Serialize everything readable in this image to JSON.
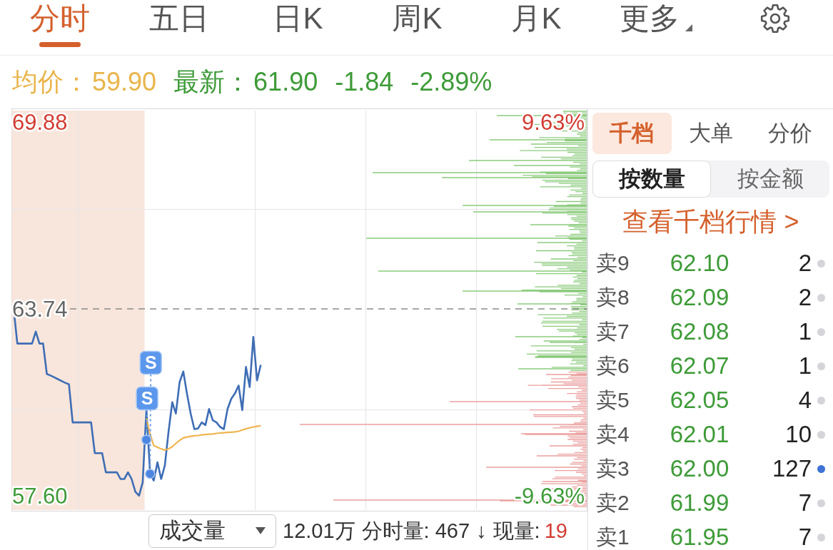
{
  "tabs": [
    {
      "label": "分时",
      "selected": true,
      "kind": "tab"
    },
    {
      "label": "五日",
      "selected": false,
      "kind": "tab"
    },
    {
      "label": "日K",
      "selected": false,
      "kind": "tab"
    },
    {
      "label": "周K",
      "selected": false,
      "kind": "tab"
    },
    {
      "label": "月K",
      "selected": false,
      "kind": "tab"
    },
    {
      "label": "更多",
      "selected": false,
      "kind": "menu"
    }
  ],
  "quote": {
    "avg_label": "均价：",
    "avg": "59.90",
    "last_label": "最新：",
    "last": "61.90",
    "change": "-1.84",
    "change_pct": "-2.89%"
  },
  "chart": {
    "auction_shade": true,
    "chart_data": [
      {
        "type": "line",
        "categories": [
          null,
          null,
          null,
          null,
          null,
          null,
          null,
          null,
          null,
          null,
          null,
          null,
          null,
          null,
          null,
          null,
          null,
          null,
          null,
          null,
          null,
          null,
          null,
          null,
          null,
          null,
          null,
          null,
          null,
          null,
          null,
          null,
          null,
          null,
          null,
          null,
          null,
          null,
          null,
          null,
          null,
          null,
          null,
          null,
          null,
          null,
          null,
          null,
          null,
          null,
          null,
          null,
          null,
          null,
          null,
          null,
          null,
          null,
          null,
          null,
          null,
          null,
          null,
          null,
          null,
          null,
          null,
          null,
          null,
          null,
          null,
          null,
          null,
          null,
          null,
          null,
          null,
          null,
          null,
          null,
          null,
          null,
          null,
          null,
          null,
          null,
          null,
          null,
          null,
          null,
          null,
          null,
          null,
          null,
          null,
          null,
          null,
          null,
          null,
          null,
          null,
          null,
          null,
          null,
          null,
          null,
          null,
          null,
          null,
          null,
          null,
          null,
          null,
          null,
          null,
          null,
          null,
          null,
          null,
          null,
          null,
          null,
          null,
          null,
          null,
          null,
          null,
          null,
          null,
          null,
          null,
          null,
          null,
          null,
          null,
          null,
          null,
          null,
          null,
          null,
          null,
          null,
          null,
          null,
          null,
          null,
          null,
          null,
          null,
          null,
          null,
          null,
          null,
          null,
          null,
          null
        ],
        "ylim": [
          57.13,
          70.3
        ],
        "yticks": [
          {
            "value": 69.88,
            "label": "69.88"
          },
          {
            "value": 63.74,
            "label": "63.74"
          },
          {
            "value": 57.6,
            "label": "57.60"
          }
        ],
        "y2lim": [
          -10.37,
          10.29
        ],
        "y2ticks": [
          {
            "value": 9.63,
            "label": "9.63%"
          },
          {
            "value": -9.63,
            "label": "-9.63%"
          }
        ],
        "grid": true,
        "ref_lines": [
          {
            "axis": "y",
            "value": 63.74,
            "color": "#8a8a8a",
            "line_style": "dashed"
          }
        ],
        "series": [
          {
            "color": "#3e6db5",
            "values": [
              63.74,
              62.6,
              62.6,
              62.6,
              62.6,
              62.6,
              62.99,
              62.6,
              62.6,
              61.6,
              61.55,
              61.49,
              61.43,
              61.37,
              61.31,
              61.26,
              60.01,
              60.01,
              60.01,
              60.01,
              60.01,
              60.01,
              59.0,
              59.0,
              59.0,
              58.37,
              58.37,
              58.37,
              58.37,
              58.15,
              58.15,
              58.37,
              58.15,
              57.73,
              57.6,
              58.04,
              60.45,
              58.32,
              58.1,
              58.7,
              58.15,
              58.59,
              59.7,
              60.67,
              60.3,
              61.33,
              61.68,
              60.96,
              60.3,
              59.79,
              59.81,
              60.01,
              59.92,
              60.45,
              60.08,
              60.01,
              59.86,
              59.79,
              60.45,
              60.78,
              60.96,
              61.22,
              60.41,
              61.83,
              61.17,
              62.82,
              61.39,
              61.9,
              null,
              null,
              null,
              null,
              null,
              null,
              null,
              null,
              null,
              null,
              null,
              null,
              null,
              null,
              null,
              null,
              null,
              null,
              null,
              null,
              null,
              null,
              null,
              null,
              null,
              null,
              null,
              null,
              null,
              null,
              null,
              null,
              null,
              null,
              null,
              null,
              null,
              null,
              null,
              null,
              null,
              null,
              null,
              null,
              null,
              null,
              null,
              null,
              null,
              null,
              null,
              null,
              null,
              null,
              null,
              null,
              null,
              null,
              null,
              null,
              null,
              null,
              null,
              null,
              null,
              null,
              null,
              null,
              null,
              null,
              null,
              null,
              null,
              null,
              null,
              null,
              null,
              null,
              null,
              null,
              null,
              null,
              null,
              null,
              null,
              null,
              null,
              null
            ]
          },
          {
            "color": "#f0b450",
            "values": [
              null,
              null,
              null,
              null,
              null,
              null,
              null,
              null,
              null,
              null,
              null,
              null,
              null,
              null,
              null,
              null,
              null,
              null,
              null,
              null,
              null,
              null,
              null,
              null,
              null,
              null,
              null,
              null,
              null,
              null,
              null,
              null,
              null,
              null,
              null,
              null,
              60.14,
              59.62,
              59.25,
              59.19,
              59.14,
              59.1,
              59.14,
              59.21,
              59.32,
              59.42,
              59.5,
              59.53,
              59.55,
              59.57,
              59.58,
              59.6,
              59.61,
              59.62,
              59.63,
              59.65,
              59.66,
              59.67,
              59.68,
              59.69,
              59.7,
              59.72,
              59.76,
              59.8,
              59.83,
              59.86,
              59.88,
              59.9,
              null,
              null,
              null,
              null,
              null,
              null,
              null,
              null,
              null,
              null,
              null,
              null,
              null,
              null,
              null,
              null,
              null,
              null,
              null,
              null,
              null,
              null,
              null,
              null,
              null,
              null,
              null,
              null,
              null,
              null,
              null,
              null,
              null,
              null,
              null,
              null,
              null,
              null,
              null,
              null,
              null,
              null,
              null,
              null,
              null,
              null,
              null,
              null,
              null,
              null,
              null,
              null,
              null,
              null,
              null,
              null,
              null,
              null,
              null,
              null,
              null,
              null,
              null,
              null,
              null,
              null,
              null,
              null,
              null,
              null,
              null,
              null,
              null,
              null,
              null,
              null,
              null,
              null,
              null,
              null,
              null,
              null,
              null,
              null,
              null,
              null,
              null,
              null
            ]
          },
          {
            "type": "scatter",
            "color": "#4d86e0",
            "values": [
              null,
              null,
              null,
              null,
              null,
              null,
              null,
              null,
              null,
              null,
              null,
              null,
              null,
              null,
              null,
              null,
              null,
              null,
              null,
              null,
              null,
              null,
              null,
              null,
              null,
              null,
              null,
              null,
              null,
              null,
              null,
              null,
              null,
              null,
              null,
              null,
              59.44,
              58.32,
              null,
              null,
              null,
              null,
              null,
              null,
              null,
              null,
              null,
              null,
              null,
              null,
              null,
              null,
              null,
              null,
              null,
              null,
              null,
              null,
              null,
              null,
              null,
              null,
              null,
              null,
              null,
              null,
              null,
              null,
              null,
              null,
              null,
              null,
              null,
              null,
              null,
              null,
              null,
              null,
              null,
              null,
              null,
              null,
              null,
              null,
              null,
              null,
              null,
              null,
              null,
              null,
              null,
              null,
              null,
              null,
              null,
              null,
              null,
              null,
              null,
              null,
              null,
              null,
              null,
              null,
              null,
              null,
              null,
              null,
              null,
              null,
              null,
              null,
              null,
              null,
              null,
              null,
              null,
              null,
              null,
              null,
              null,
              null,
              null,
              null,
              null,
              null,
              null,
              null,
              null,
              null,
              null,
              null,
              null,
              null,
              null,
              null,
              null,
              null,
              null,
              null,
              null,
              null,
              null,
              null,
              null,
              null,
              null,
              null,
              null,
              null,
              null,
              null,
              null,
              null,
              null,
              null
            ]
          }
        ],
        "annotations": [
          "S",
          "S"
        ]
      }
    ]
  },
  "volume_bar": {
    "indicator": "成交量",
    "total": "12.01万",
    "minute_volume": "分时量: 467",
    "arrow": "↓",
    "current_label": "现量:",
    "current": "19",
    "current_buy": true
  },
  "order_panel": {
    "tabs": [
      {
        "label": "千档",
        "selected": true
      },
      {
        "label": "大单",
        "selected": false
      },
      {
        "label": "分价",
        "selected": false
      }
    ],
    "modes": [
      {
        "label": "按数量",
        "selected": true
      },
      {
        "label": "按金额",
        "selected": false
      }
    ],
    "link": "查看千档行情 >",
    "asks": [
      {
        "label": "卖9",
        "price": "62.10",
        "qty": "2",
        "color": "#d4d4d9"
      },
      {
        "label": "卖8",
        "price": "62.09",
        "qty": "2",
        "color": "#d4d4d9"
      },
      {
        "label": "卖7",
        "price": "62.08",
        "qty": "1",
        "color": "#d4d4d9"
      },
      {
        "label": "卖6",
        "price": "62.07",
        "qty": "1",
        "color": "#d4d4d9"
      },
      {
        "label": "卖5",
        "price": "62.05",
        "qty": "4",
        "color": "#d4d4d9"
      },
      {
        "label": "卖4",
        "price": "62.01",
        "qty": "10",
        "color": "#d4d4d9"
      },
      {
        "label": "卖3",
        "price": "62.00",
        "qty": "127",
        "color": "#3f72d6"
      },
      {
        "label": "卖2",
        "price": "61.99",
        "qty": "7",
        "color": "#d4d4d9"
      },
      {
        "label": "卖1",
        "price": "61.95",
        "qty": "7",
        "color": "#d4d4d9"
      }
    ]
  }
}
